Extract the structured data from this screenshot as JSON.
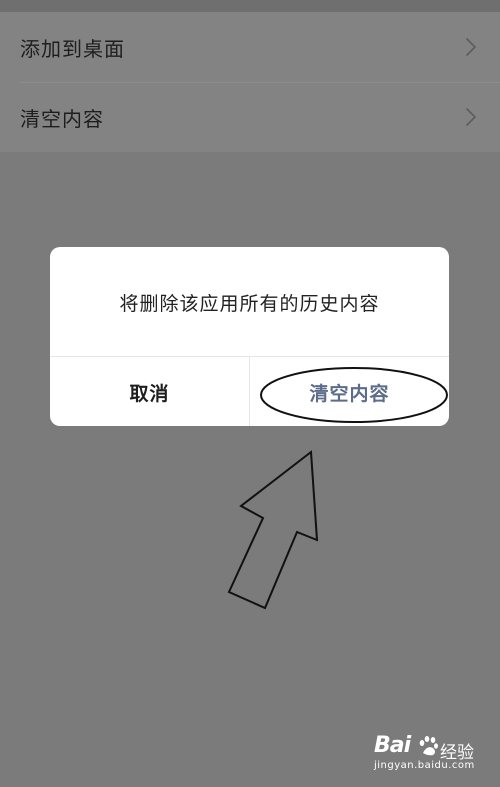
{
  "menu": {
    "items": [
      {
        "label": "添加到桌面",
        "icon": "chevron-right-icon"
      },
      {
        "label": "清空内容",
        "icon": "chevron-right-icon"
      }
    ]
  },
  "dialog": {
    "message": "将删除该应用所有的历史内容",
    "cancel_label": "取消",
    "confirm_label": "清空内容"
  },
  "watermark": {
    "brand": "Bai",
    "brand_cn": "经验",
    "url": "jingyan.baidu.com"
  },
  "colors": {
    "overlay": "#7b7b7b",
    "menu_bg": "#838383",
    "dialog_bg": "#ffffff",
    "confirm_text": "#5c6c8a",
    "cancel_text": "#1e1e1e"
  }
}
